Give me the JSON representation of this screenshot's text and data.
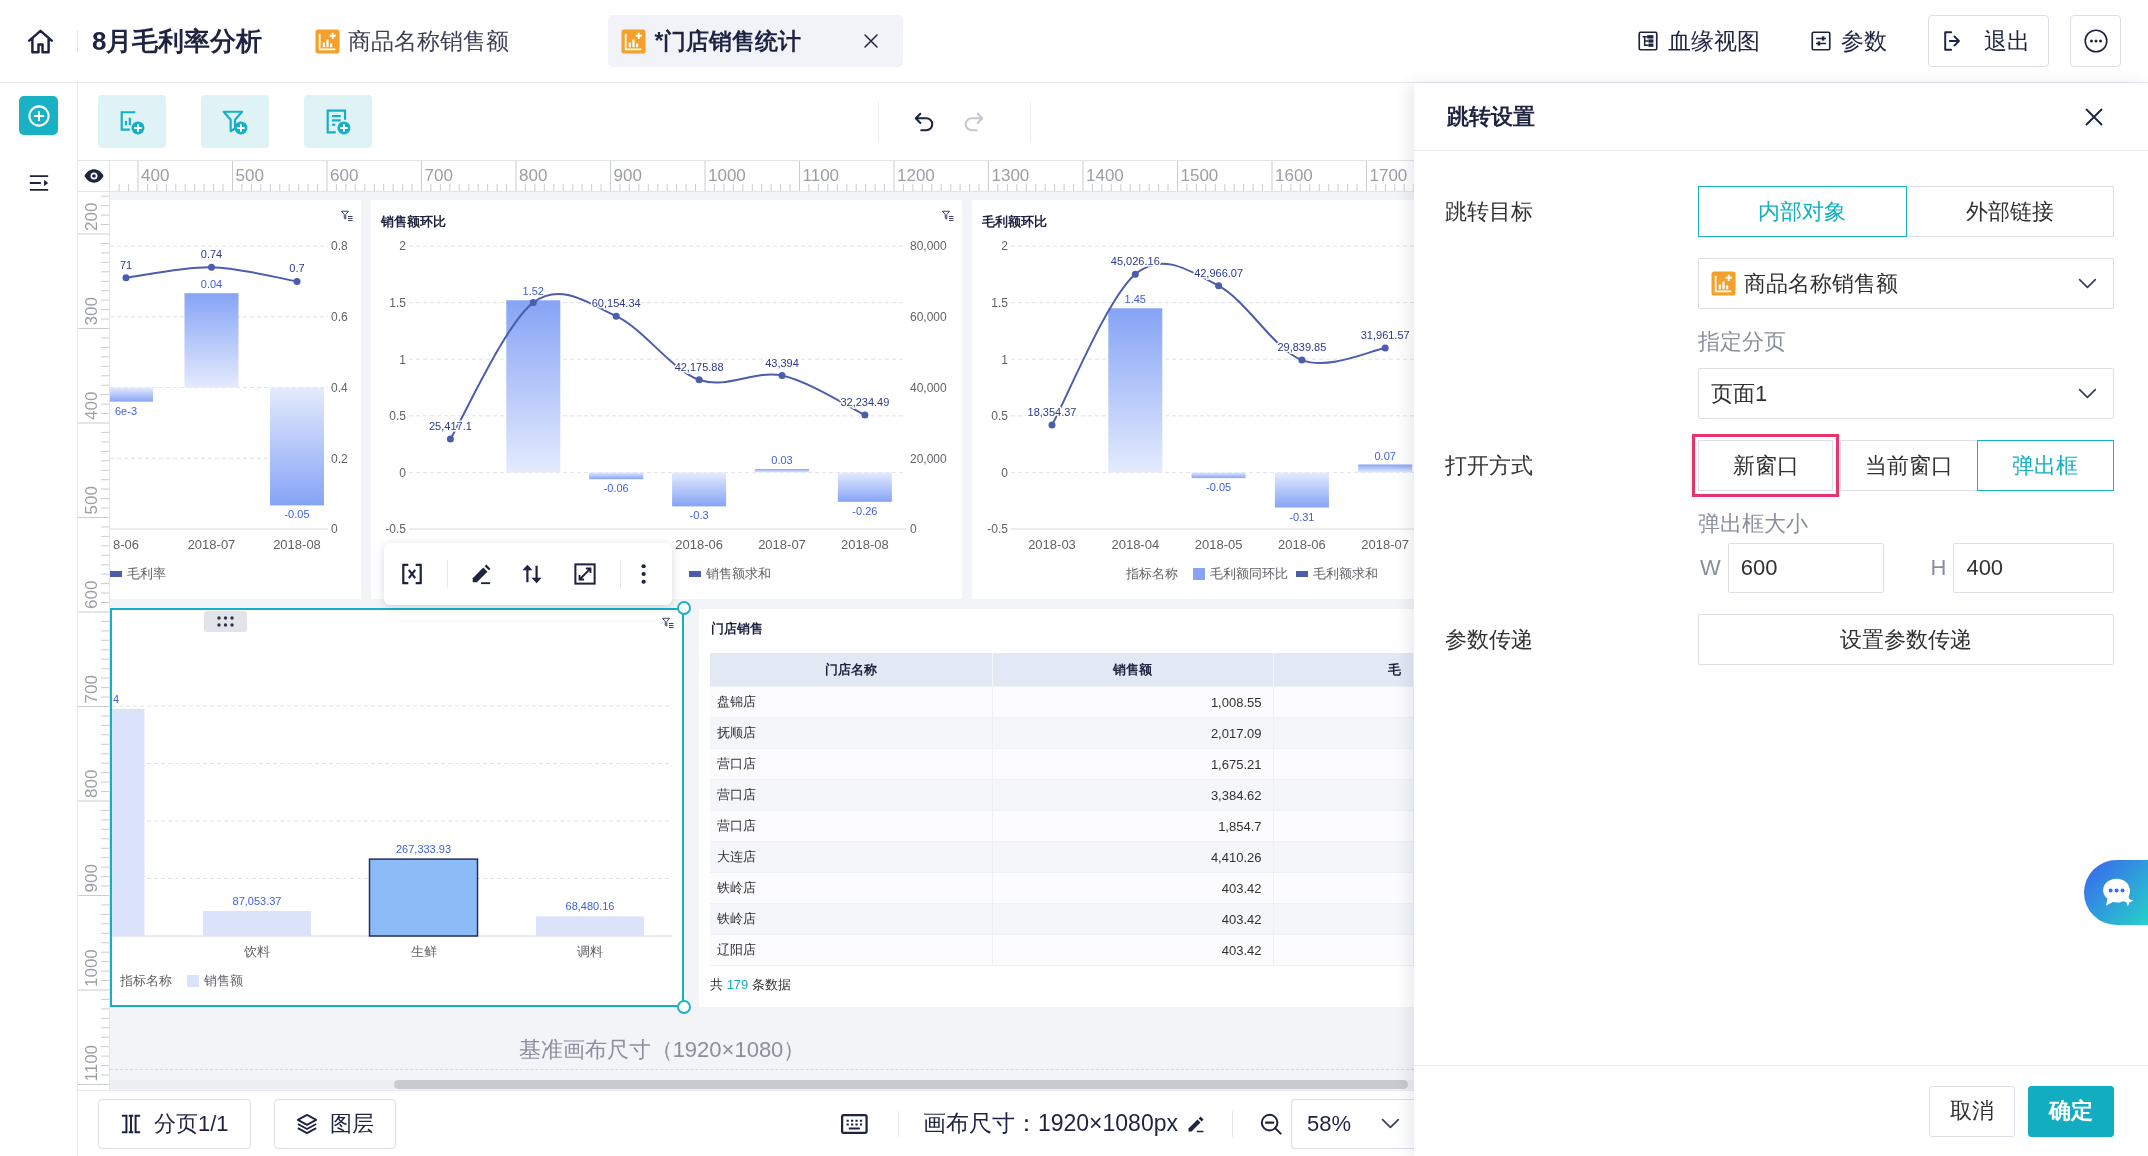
{
  "top_bar": {
    "title": "8月毛利率分析",
    "tabs": [
      {
        "label": "商品名称销售额",
        "selected": false
      },
      {
        "label": "*门店销售统计",
        "selected": true
      }
    ],
    "actions": [
      {
        "kind": "lineage",
        "label": "血缘视图"
      },
      {
        "kind": "params",
        "label": "参数"
      },
      {
        "kind": "exit",
        "label": "退出"
      },
      {
        "kind": "more"
      }
    ]
  },
  "toolbar": {
    "history": [
      {
        "kind": "undo",
        "disabled": false
      },
      {
        "kind": "redo",
        "disabled": true
      }
    ]
  },
  "rulers": {
    "horizontal": [
      "400",
      "500",
      "600",
      "700",
      "800",
      "900",
      "1000",
      "1100",
      "1200",
      "1300",
      "1400",
      "1500",
      "1600",
      "1700"
    ],
    "vertical": [
      "200",
      "300",
      "400",
      "500",
      "600",
      "700",
      "800",
      "900",
      "1000",
      "1100"
    ]
  },
  "canvas": {
    "widgets": [
      {
        "kind": "combo",
        "selected": false,
        "chart_data": {
          "type": "bar",
          "categories": [
            "8-06",
            "2018-07",
            "2018-08"
          ],
          "grid": true,
          "ylim": [
            -0.06,
            0.06
          ],
          "y2lim": [
            0,
            0.8
          ],
          "y2ticks": [
            0,
            0.2,
            0.4,
            0.6,
            0.8
          ],
          "series": [
            {
              "color": "#86a4f6",
              "values": [
                -0.006,
                0.04,
                -0.05
              ],
              "value_labels": [
                null,
                "0.04",
                "-0.05"
              ]
            },
            {
              "name": "毛利率",
              "type": "line",
              "axis": "y2",
              "marker": "circle",
              "color": "#4c5dab",
              "values": [
                0.71,
                0.74,
                0.7
              ],
              "value_labels": [
                null,
                "0.74",
                "0.7"
              ]
            }
          ],
          "annotations": [
            {
              "text": "6e-3",
              "x": "8-06",
              "y": -0.006
            },
            {
              "text": "71",
              "x": "8-06",
              "y": 0.0465
            }
          ]
        }
      },
      {
        "kind": "combo",
        "selected": false,
        "title": "销售额环比",
        "chart_data": {
          "type": "bar",
          "categories": [
            null,
            null,
            null,
            "2018-06",
            "2018-07",
            "2018-08"
          ],
          "grid": true,
          "ylim": [
            -0.5,
            2
          ],
          "yticks": [
            -0.5,
            0,
            0.5,
            1,
            1.5,
            2
          ],
          "y2lim": [
            0,
            80000
          ],
          "y2ticks": [
            {
              "value": 0,
              "label": "0"
            },
            {
              "value": 20000,
              "label": "20,000"
            },
            {
              "value": 40000,
              "label": "40,000"
            },
            {
              "value": 60000,
              "label": "60,000"
            },
            {
              "value": 80000,
              "label": "80,000"
            }
          ],
          "series": [
            {
              "color": "#86a4f6",
              "values": [
                null,
                1.52,
                -0.06,
                -0.3,
                0.03,
                -0.26
              ],
              "value_labels": [
                null,
                "1.52",
                "-0.06",
                "-0.3",
                "0.03",
                "-0.26"
              ]
            },
            {
              "name": "销售额求和",
              "type": "line",
              "axis": "y2",
              "marker": "circle",
              "color": "#4c5dab",
              "values": [
                25417.1,
                64000,
                60154.34,
                42175.88,
                43394,
                32234.49
              ],
              "value_labels": [
                "25,417.1",
                null,
                "60,154.34",
                "42,175.88",
                "43,394",
                "32,234.49"
              ]
            }
          ]
        }
      },
      {
        "kind": "combo",
        "selected": false,
        "title": "毛利额环比",
        "legend_title": "指标名称",
        "chart_data": {
          "type": "bar",
          "categories": [
            "2018-03",
            "2018-04",
            "2018-05",
            "2018-06",
            "2018-07"
          ],
          "grid": true,
          "ylim": [
            -0.5,
            2
          ],
          "yticks": [
            -0.5,
            0,
            0.5,
            1,
            1.5,
            2
          ],
          "y2lim": [
            0,
            50000
          ],
          "series": [
            {
              "name": "毛利额同环比",
              "color": "#86a4f6",
              "values": [
                null,
                1.45,
                -0.05,
                -0.31,
                0.07
              ],
              "value_labels": [
                null,
                "1.45",
                "-0.05",
                "-0.31",
                "0.07"
              ]
            },
            {
              "name": "毛利额求和",
              "type": "line",
              "axis": "y2",
              "marker": "circle",
              "color": "#4c5dab",
              "values": [
                18354.37,
                45026.16,
                42966.07,
                29839.85,
                31961.57
              ],
              "value_labels": [
                "18,354.37",
                "45,026.16",
                "42,966.07",
                "29,839.85",
                "31,961.57"
              ]
            }
          ]
        }
      },
      {
        "kind": "bar",
        "selected": true,
        "legend_title": "指标名称",
        "bars": [
          {
            "selected": false
          },
          {
            "selected": false
          },
          {
            "selected": true
          },
          {
            "selected": false
          }
        ],
        "chart_data": {
          "type": "bar",
          "categories": [
            null,
            "饮料",
            "生鲜",
            "调料"
          ],
          "grid": true,
          "series": [
            {
              "name": "销售额",
              "color": "#dbe3fb",
              "values": [
                790000,
                87053.37,
                null,
                68480.16
              ],
              "value_labels": [
                null,
                "87,053.37",
                null,
                "68,480.16"
              ]
            },
            {
              "color": "#8cbcf8",
              "values": [
                null,
                null,
                267333.93,
                null
              ],
              "value_labels": [
                null,
                null,
                "267,333.93",
                null
              ]
            }
          ],
          "annotations": [
            {
              "text": "4",
              "y": 790000
            }
          ]
        }
      },
      {
        "kind": "table",
        "selected": false,
        "title": "门店销售",
        "columns": [
          "门店名称",
          "销售额",
          "毛"
        ],
        "rows": [
          [
            "盘锦店",
            "1,008.55"
          ],
          [
            "抚顺店",
            "2,017.09"
          ],
          [
            "营口店",
            "1,675.21"
          ],
          [
            "营口店",
            "3,384.62"
          ],
          [
            "营口店",
            "1,854.7"
          ],
          [
            "大连店",
            "4,410.26"
          ],
          [
            "铁岭店",
            "403.42"
          ],
          [
            "铁岭店",
            "403.42"
          ],
          [
            "辽阳店",
            "403.42"
          ]
        ],
        "footer": {
          "prefix": "共",
          "count": "179",
          "suffix": "条数据"
        }
      }
    ],
    "caption": "基准画布尺寸（1920×1080）"
  },
  "bottom_bar": {
    "pages": "分页1/1",
    "layers": "图层",
    "canvas_size": "画布尺寸：1920×1080px",
    "zoom": "58%"
  },
  "panel": {
    "title": "跳转设置",
    "rows": [
      {
        "kind": "segmented",
        "label": "跳转目标",
        "options": [
          {
            "label": "内部对象",
            "selected": true,
            "highlighted": false
          },
          {
            "label": "外部链接",
            "selected": false,
            "highlighted": false
          }
        ]
      },
      {
        "kind": "object-select",
        "value": "商品名称销售额"
      },
      {
        "kind": "select",
        "caption": "指定分页",
        "value": "页面1"
      },
      {
        "kind": "segmented",
        "label": "打开方式",
        "options": [
          {
            "label": "新窗口",
            "selected": false,
            "highlighted": true
          },
          {
            "label": "当前窗口",
            "selected": false,
            "highlighted": false
          },
          {
            "label": "弹出框",
            "selected": true,
            "highlighted": false
          }
        ]
      },
      {
        "kind": "size",
        "caption": "弹出框大小",
        "fields": [
          {
            "label": "W",
            "value": "600"
          },
          {
            "label": "H",
            "value": "400"
          }
        ]
      },
      {
        "kind": "action",
        "label": "参数传递",
        "button": "设置参数传递"
      }
    ],
    "buttons": [
      {
        "kind": "secondary",
        "label": "取消"
      },
      {
        "kind": "primary",
        "label": "确定"
      }
    ]
  }
}
